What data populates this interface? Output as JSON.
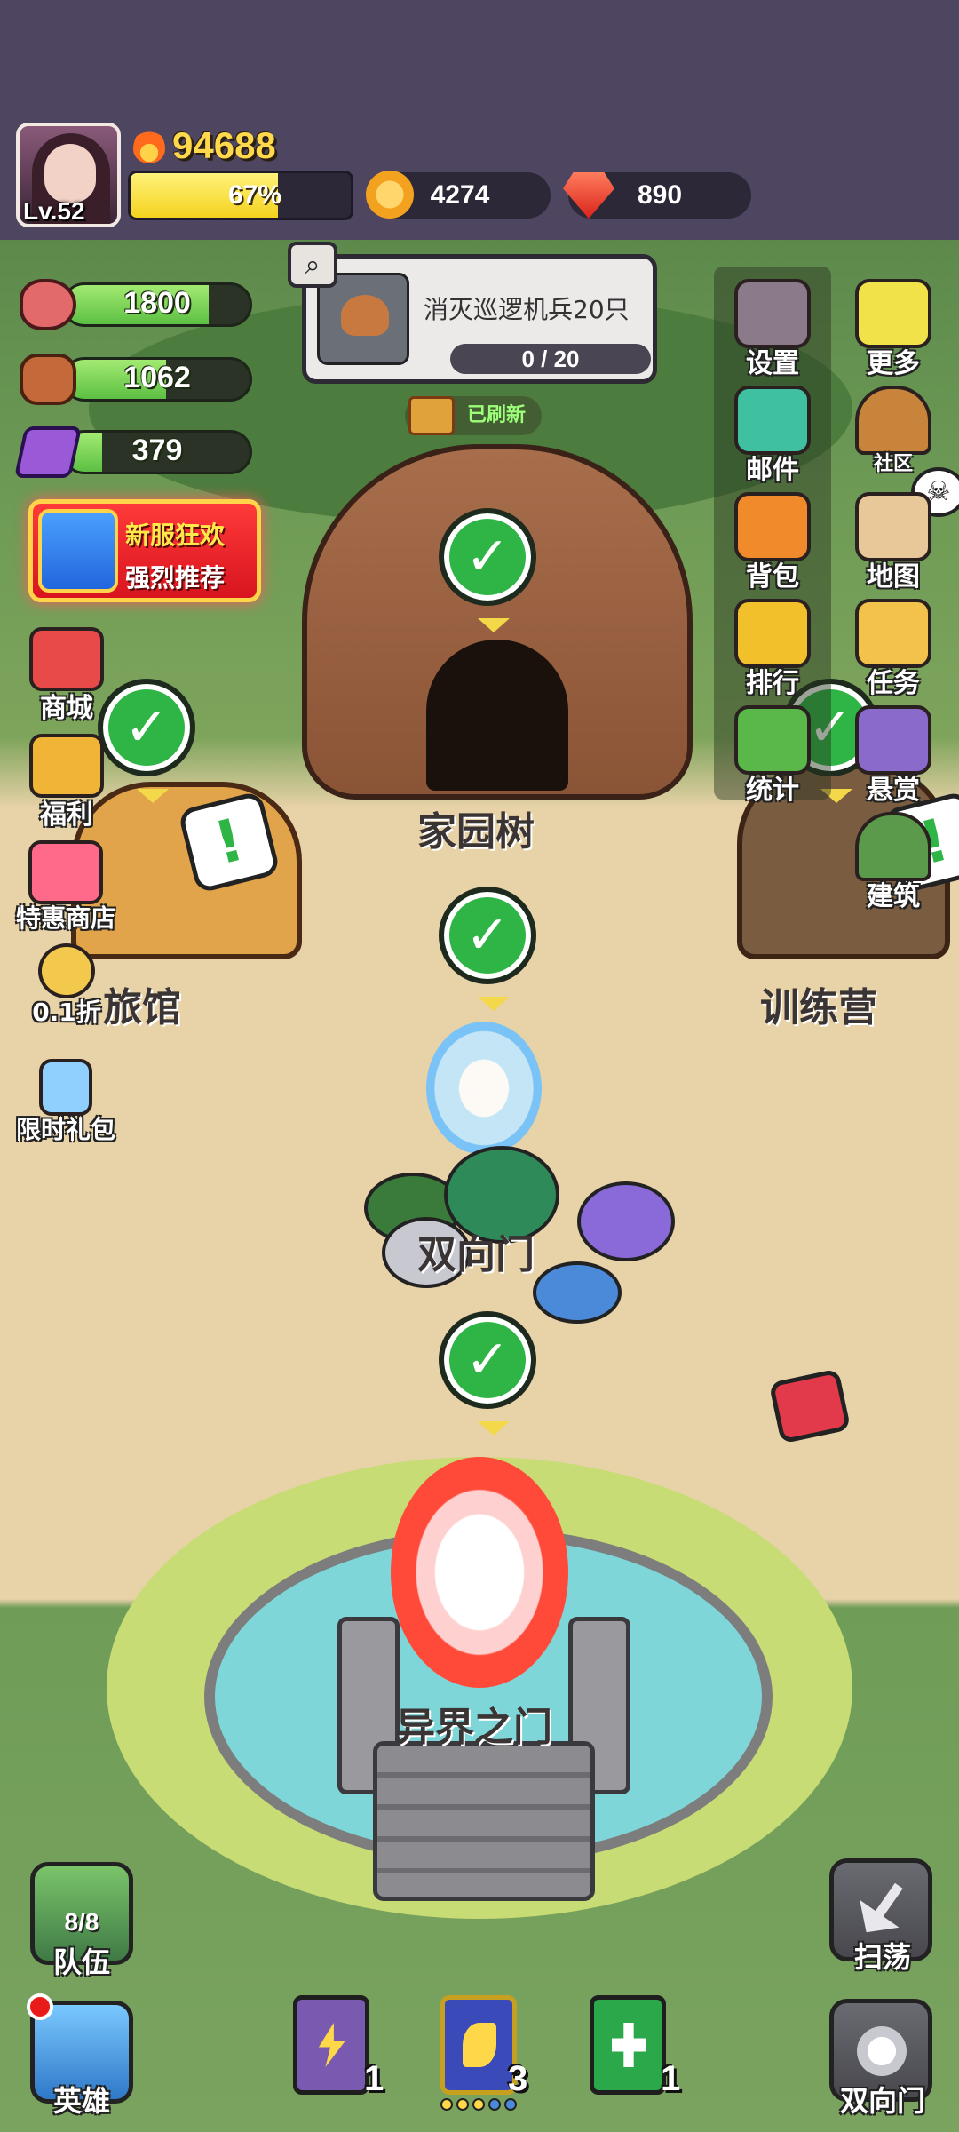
{
  "player": {
    "level": "Lv.52",
    "power": "94688",
    "xp_percent_text": "67%",
    "xp_fraction": 0.67,
    "coins": "4274",
    "gems": "890"
  },
  "resources": [
    {
      "name": "meat-icon",
      "value": "1800",
      "fill": 0.78
    },
    {
      "name": "wood-icon",
      "value": "1062",
      "fill": 0.55
    },
    {
      "name": "ore-icon",
      "value": "379",
      "fill": 0.2
    }
  ],
  "quest": {
    "title": "消灭巡逻机兵20只",
    "progress": "0 / 20",
    "refresh_label": "已刷新"
  },
  "promo": {
    "line1": "新服狂欢",
    "line2": "强烈推荐"
  },
  "left_menu": [
    {
      "label": "商城",
      "icon": "shop-icon",
      "color": "#e84a4a"
    },
    {
      "label": "福利",
      "icon": "gift-icon",
      "color": "#f0b437"
    },
    {
      "label": "特惠商店",
      "icon": "sale-shop-icon",
      "color": "#ff6a8a"
    },
    {
      "label": "0.1折",
      "icon": "discount-icon",
      "color": "#f2c94c"
    },
    {
      "label": "限时礼包",
      "icon": "hourglass-icon",
      "color": "#8fd0ff"
    }
  ],
  "right_menu": {
    "col1": [
      {
        "label": "设置",
        "icon": "gear-icon",
        "color": "#8a7a8a"
      },
      {
        "label": "邮件",
        "icon": "mail-icon",
        "color": "#3fc0a0"
      },
      {
        "label": "背包",
        "icon": "backpack-icon",
        "color": "#f08a2a"
      },
      {
        "label": "排行",
        "icon": "trophy-icon",
        "color": "#f2c02a"
      },
      {
        "label": "统计",
        "icon": "stats-book-icon",
        "color": "#5ab84a"
      }
    ],
    "col2": [
      {
        "label": "更多",
        "icon": "more-icon",
        "color": "#f2e24a"
      },
      {
        "label": "社区",
        "icon": "community-house-icon",
        "color": "#c8843a"
      },
      {
        "label": "地图",
        "icon": "map-icon",
        "color": "#e8c898"
      },
      {
        "label": "任务",
        "icon": "quest-scroll-icon",
        "color": "#f2c24a"
      },
      {
        "label": "悬赏",
        "icon": "bounty-icon",
        "color": "#8a6aca"
      },
      {
        "label": "建筑",
        "icon": "building-icon",
        "color": "#5a9a4a"
      }
    ]
  },
  "locations": {
    "home_tree": "家园树",
    "inn": "旅馆",
    "training_camp": "训练营",
    "two_way_gate": "双向门",
    "otherworld_gate": "异界之门"
  },
  "bottom": {
    "team_label": "队伍",
    "team_count": "8/8",
    "heroes_label": "英雄",
    "sweep_label": "扫荡",
    "gate_label": "双向门",
    "books": [
      {
        "name": "lightning-book-icon",
        "count": "1",
        "color": "#7a5ab0"
      },
      {
        "name": "golden-book-icon",
        "count": "3",
        "color": "#3a4ab8"
      },
      {
        "name": "heal-book-icon",
        "count": "1",
        "color": "#2aa84a"
      }
    ]
  }
}
